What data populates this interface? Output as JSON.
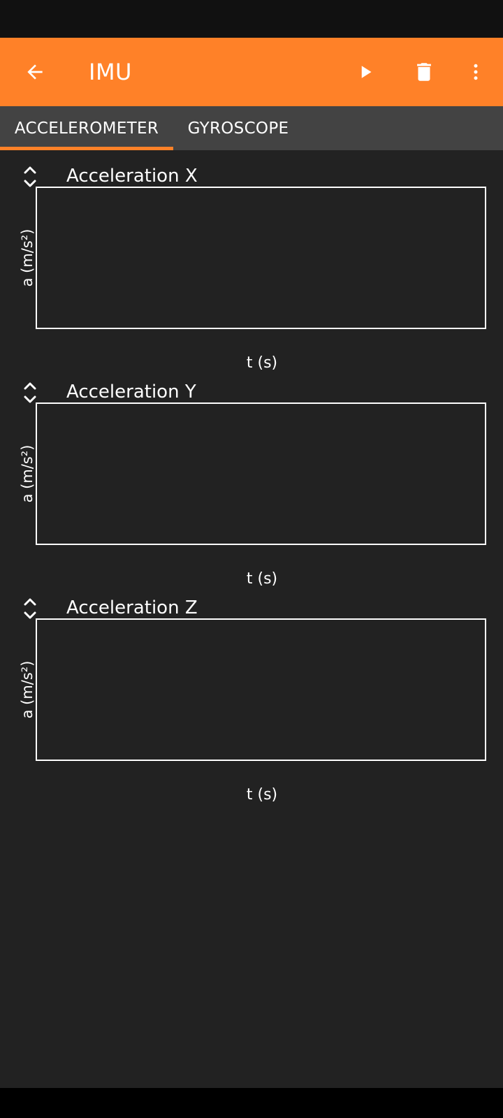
{
  "app_bar": {
    "title": "IMU",
    "back_icon": "arrow-left-icon",
    "play_icon": "play-icon",
    "delete_icon": "trash-icon",
    "more_icon": "more-vertical-icon",
    "color": "#ff8128"
  },
  "tabs": [
    {
      "label": "ACCELEROMETER",
      "selected": true
    },
    {
      "label": "GYROSCOPE",
      "selected": false
    }
  ],
  "graphs": [
    {
      "title": "Acceleration X",
      "ylabel": "a (m/s²)",
      "xlabel": "t (s)"
    },
    {
      "title": "Acceleration Y",
      "ylabel": "a (m/s²)",
      "xlabel": "t (s)"
    },
    {
      "title": "Acceleration Z",
      "ylabel": "a (m/s²)",
      "xlabel": "t (s)"
    }
  ],
  "colors": {
    "background": "#222222",
    "tab_bar": "#434343",
    "accent": "#ff8128"
  }
}
